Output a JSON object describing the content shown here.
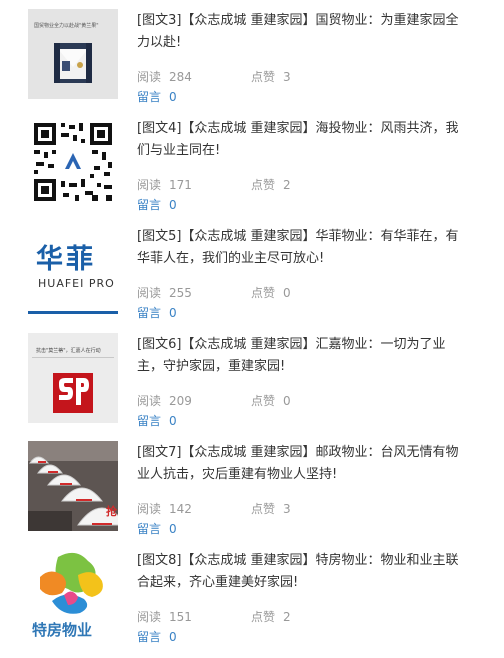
{
  "labels": {
    "read": "阅读",
    "like": "点赞",
    "comment": "留言"
  },
  "colors": {
    "link": "#3a82c5",
    "meta": "#999999",
    "text": "#333333",
    "huafei_blue": "#1a5fa8"
  },
  "articles": [
    {
      "title": "[图文3]【众志成城 重建家园】国贸物业：为重建家园全力以赴!",
      "reads": "284",
      "likes": "3",
      "comments": "0",
      "thumb": {
        "kind": "photo-security-guard",
        "banner": "国贸物业全力以赴战\"黄兰果\""
      }
    },
    {
      "title": "[图文4]【众志成城 重建家园】海投物业：风雨共济，我们与业主同在!",
      "reads": "171",
      "likes": "2",
      "comments": "0",
      "thumb": {
        "kind": "qr-code-icon"
      }
    },
    {
      "title": "[图文5]【众志成城 重建家园】华菲物业：有华菲在，有华菲人在，我们的业主尽可放心!",
      "reads": "255",
      "likes": "0",
      "comments": "0",
      "thumb": {
        "kind": "huafei-logo",
        "logo_text": "华菲",
        "logo_subtext": "HUAFEI PRO"
      }
    },
    {
      "title": "[图文6]【众志成城 重建家园】汇嘉物业：一切为了业主，守护家园，重建家园!",
      "reads": "209",
      "likes": "0",
      "comments": "0",
      "thumb": {
        "kind": "sp-logo",
        "banner": "抗击\"莫兰蒂\"，汇嘉人在行动"
      }
    },
    {
      "title": "[图文7]【众志成城 重建家园】邮政物业：台风无情有物业人抗击，灾后重建有物业人坚持!",
      "reads": "142",
      "likes": "3",
      "comments": "0",
      "thumb": {
        "kind": "photo-helmets",
        "helmet_text": "抢"
      }
    },
    {
      "title": "[图文8]【众志成城 重建家园】特房物业：物业和业主联合起来，齐心重建美好家园!",
      "reads": "151",
      "likes": "2",
      "comments": "0",
      "thumb": {
        "kind": "tefang-logo",
        "logo_text": "特房物业"
      }
    }
  ]
}
